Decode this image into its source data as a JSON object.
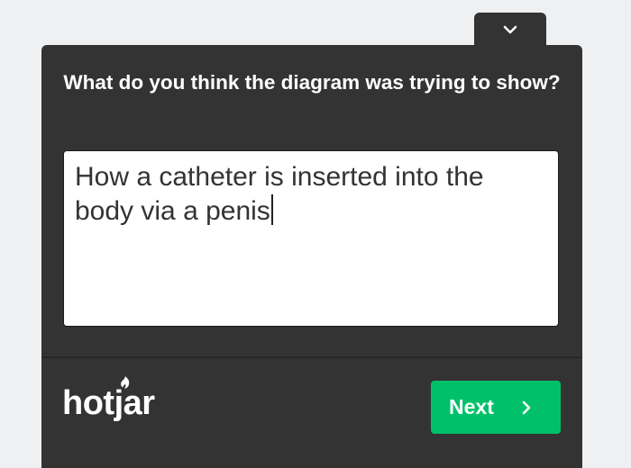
{
  "survey": {
    "question": "What do you think the diagram was trying to show?",
    "answer_value": "How a catheter is inserted into the body via a penis",
    "next_label": "Next",
    "collapse_icon": "chevron-down-icon",
    "next_icon": "chevron-right-icon"
  },
  "branding": {
    "logo_text": "hotjar"
  },
  "colors": {
    "panel_background": "#333333",
    "page_background": "#eef0f1",
    "next_button": "#00c16a",
    "text_light": "#ffffff"
  }
}
